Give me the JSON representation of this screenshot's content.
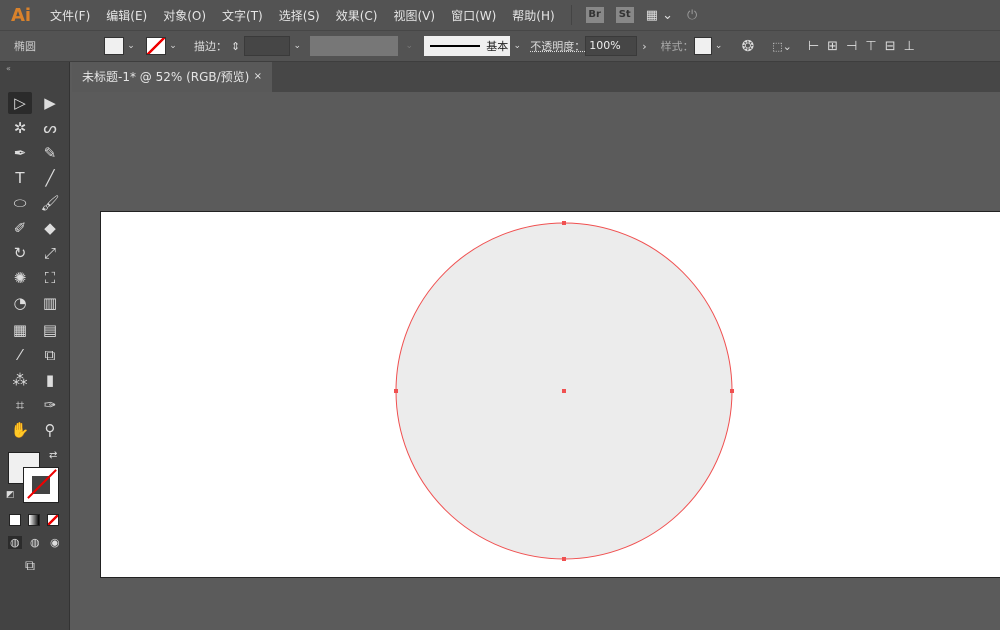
{
  "app": {
    "logo": "Ai"
  },
  "menu": [
    "文件(F)",
    "编辑(E)",
    "对象(O)",
    "文字(T)",
    "选择(S)",
    "效果(C)",
    "视图(V)",
    "窗口(W)",
    "帮助(H)"
  ],
  "menu_icons": {
    "bridge": "Br",
    "stock": "St"
  },
  "control": {
    "object_type": "椭圆",
    "stroke_label": "描边：",
    "stroke_profile": "基本",
    "opacity_label": "不透明度：",
    "opacity_value": "100%",
    "style_label": "样式："
  },
  "document_tab": {
    "title": "未标题-1* @ 52% (RGB/预览)",
    "close": "×"
  },
  "colors": {
    "fill": "#ececec",
    "stroke": "#f05050",
    "accent": "#d9822b"
  },
  "tools": [
    [
      "selection-tool",
      "▷"
    ],
    [
      "direct-selection-tool",
      "▶"
    ],
    [
      "magic-wand-tool",
      "✲"
    ],
    [
      "lasso-tool",
      "ᔕ"
    ],
    [
      "pen-tool",
      "✒"
    ],
    [
      "curvature-tool",
      "✎"
    ],
    [
      "type-tool",
      "T"
    ],
    [
      "line-tool",
      "╱"
    ],
    [
      "ellipse-tool",
      "⬭"
    ],
    [
      "paintbrush-tool",
      "🖌"
    ],
    [
      "shaper-tool",
      "✐"
    ],
    [
      "eraser-tool",
      "◆"
    ],
    [
      "rotate-tool",
      "↻"
    ],
    [
      "scale-tool",
      "⤢"
    ],
    [
      "puppet-warp-tool",
      "✺"
    ],
    [
      "free-transform-tool",
      "⛶"
    ],
    [
      "shape-builder-tool",
      "◔"
    ],
    [
      "perspective-grid-tool",
      "▥"
    ],
    [
      "mesh-tool",
      "▦"
    ],
    [
      "gradient-tool",
      "▤"
    ],
    [
      "eyedropper-tool",
      "⁄"
    ],
    [
      "blend-tool",
      "⧉"
    ],
    [
      "symbol-sprayer-tool",
      "⁂"
    ],
    [
      "column-graph-tool",
      "▮"
    ],
    [
      "artboard-tool",
      "⌗"
    ],
    [
      "slice-tool",
      "✑"
    ],
    [
      "hand-tool",
      "✋"
    ],
    [
      "zoom-tool",
      "⚲"
    ]
  ]
}
